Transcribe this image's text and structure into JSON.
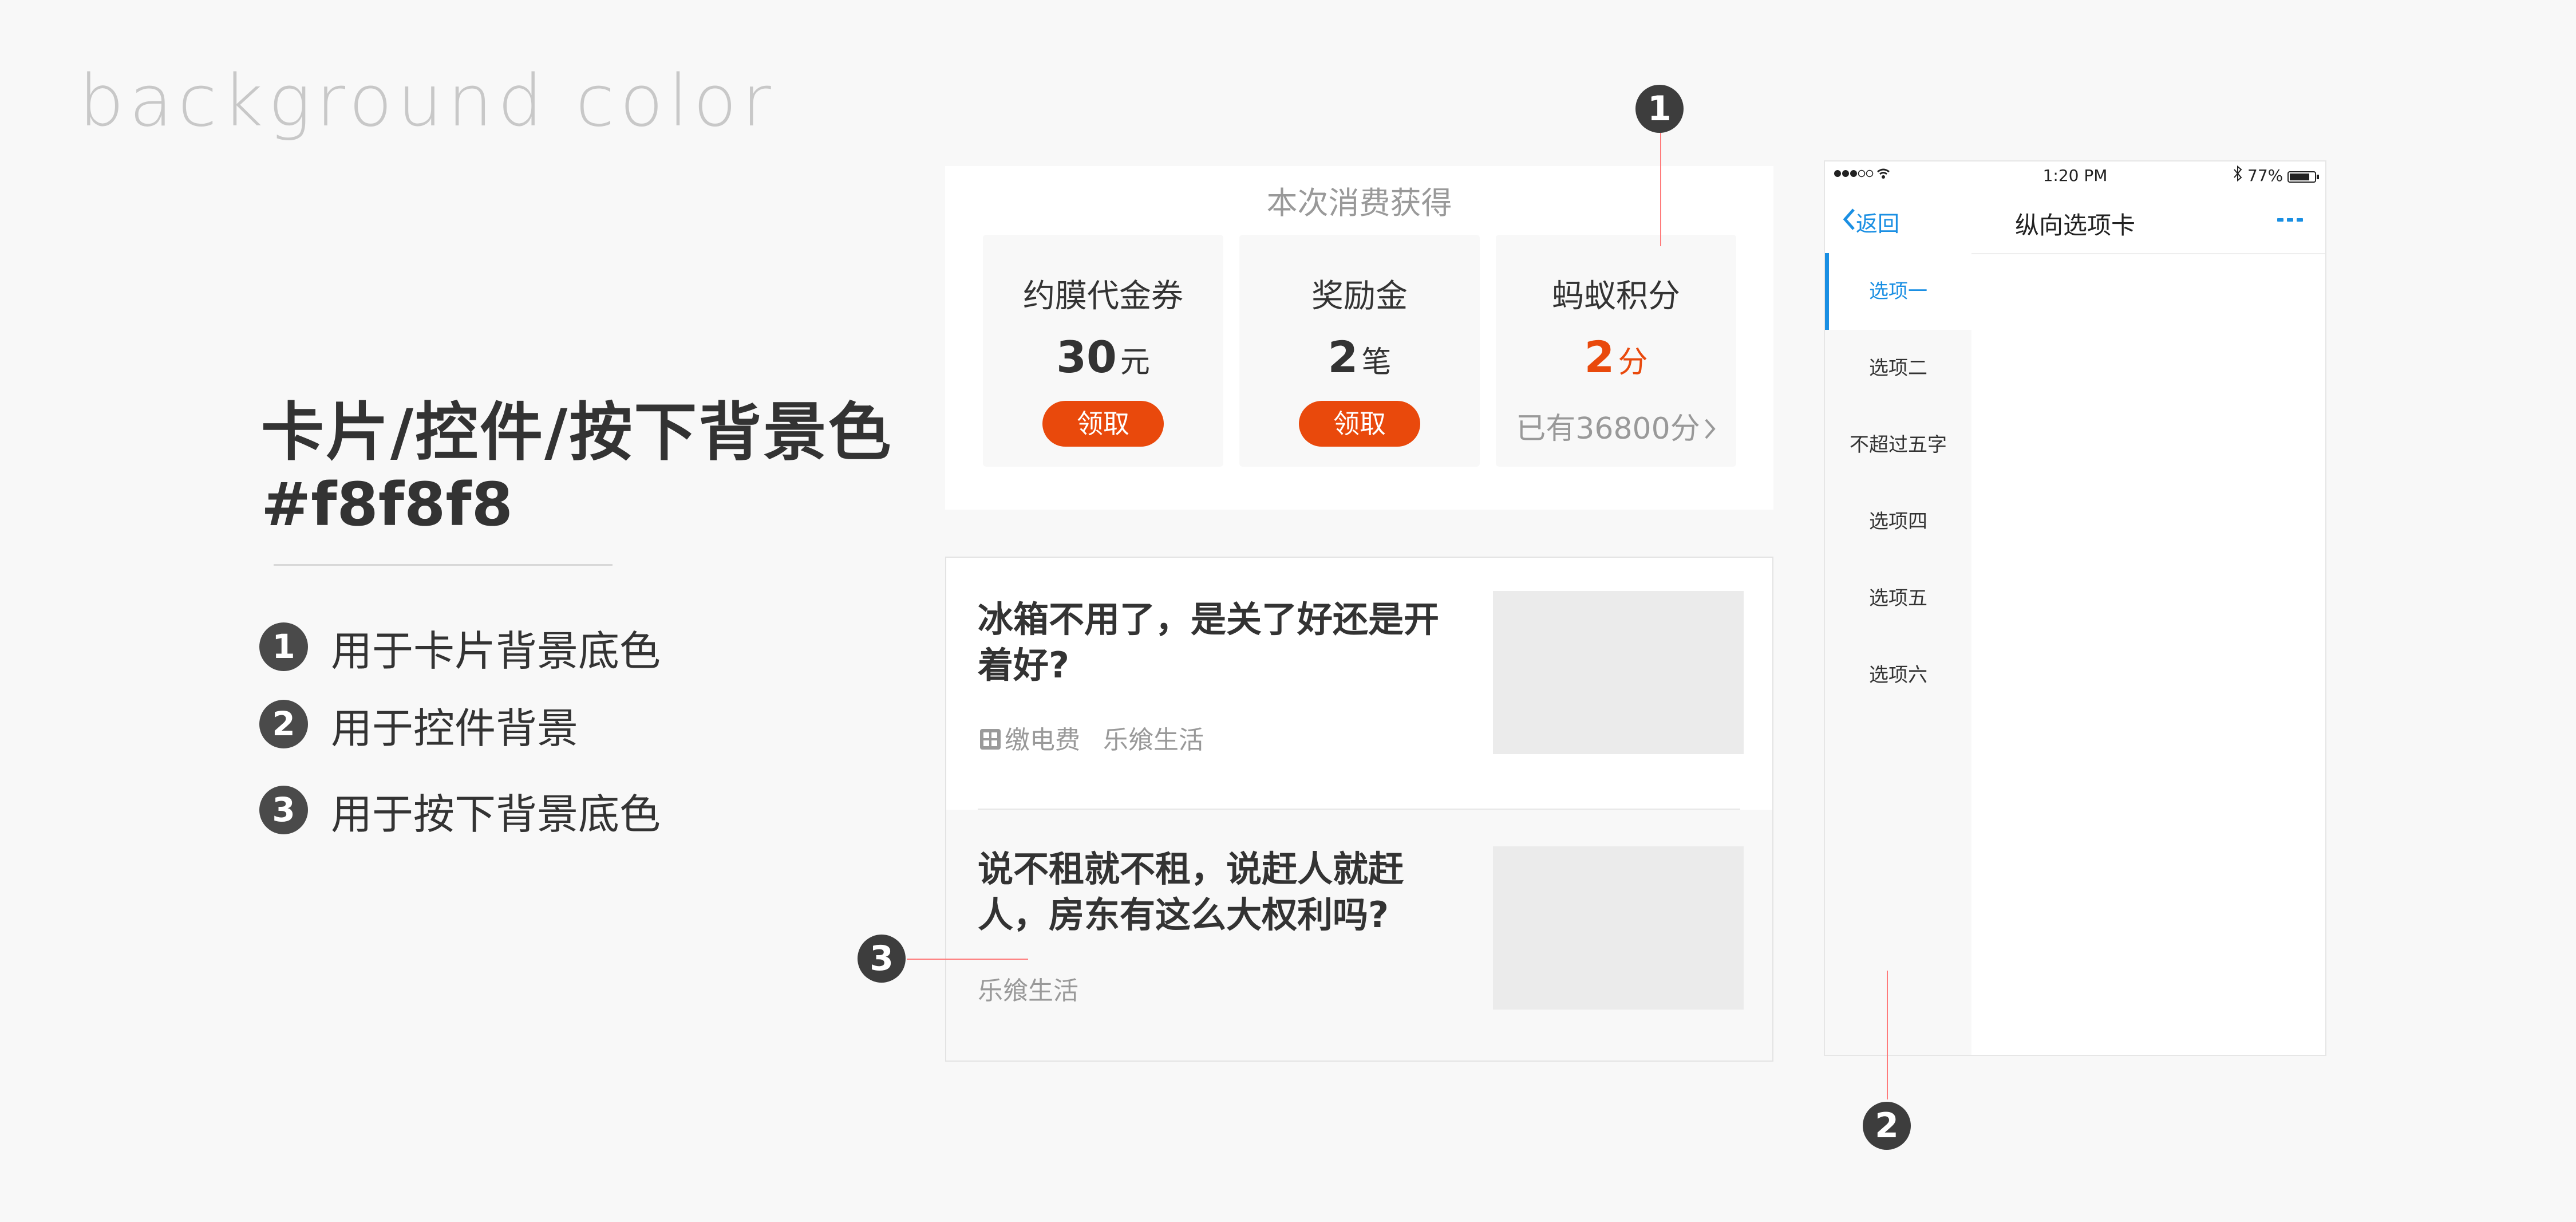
{
  "page_title": "background color",
  "heading": "卡片/控件/按下背景色",
  "hex": "#f8f8f8",
  "accent_color": "#e9490c",
  "tab_active_color": "#1a8fe3",
  "legend": [
    {
      "num": "1",
      "text": "用于卡片背景底色"
    },
    {
      "num": "2",
      "text": "用于控件背景"
    },
    {
      "num": "3",
      "text": "用于按下背景底色"
    }
  ],
  "callouts": {
    "c1": "1",
    "c2": "2",
    "c3": "3"
  },
  "card1": {
    "title": "本次消费获得",
    "items": [
      {
        "label": "约膜代金券",
        "value": "30",
        "unit": "元",
        "button": "领取"
      },
      {
        "label": "奖励金",
        "value": "2",
        "unit": "笔",
        "button": "领取"
      },
      {
        "label": "蚂蚁积分",
        "value": "2",
        "unit": "分",
        "note": "已有36800分"
      }
    ]
  },
  "news": [
    {
      "title": "冰箱不用了，是关了好还是开着好?",
      "tag": "缴电费",
      "source": "乐飨生活"
    },
    {
      "title": "说不租就不租，说赶人就赶人，房东有这么大权利吗?",
      "source": "乐飨生活"
    }
  ],
  "phone": {
    "status_time": "1:20 PM",
    "battery": "77%",
    "back_label": "返回",
    "nav_title": "纵向选项卡",
    "more_icon": "ellipsis-icon",
    "tabs": [
      "选项一",
      "选项二",
      "不超过五字",
      "选项四",
      "选项五",
      "选项六"
    ]
  }
}
